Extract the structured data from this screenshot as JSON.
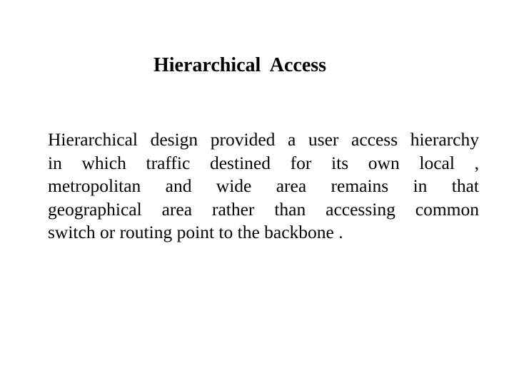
{
  "slide": {
    "title": "Hierarchical  Access",
    "body_lines": [
      "Hierarchical design provided a user access hierarchy",
      "in which traffic destined for its own local ,",
      "metropolitan and wide area remains in that",
      "geographical area rather than accessing common",
      "switch or routing point to the backbone ."
    ]
  }
}
